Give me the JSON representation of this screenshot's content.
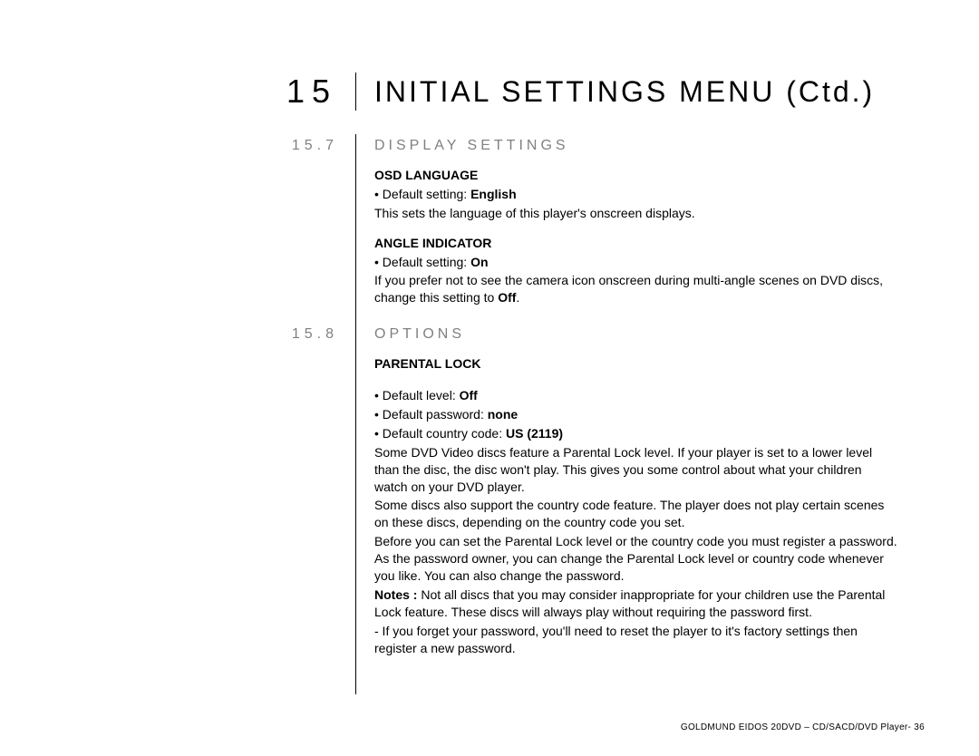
{
  "chapter": {
    "number": "15",
    "title": "INITIAL SETTINGS MENU (Ctd.)"
  },
  "sections": {
    "s1": {
      "num": "15.7",
      "title": "DISPLAY SETTINGS",
      "osd": {
        "head": "OSD LANGUAGE",
        "b1_pre": "• Default setting: ",
        "b1_bold": "English",
        "p1": "This sets the language of this player's onscreen displays."
      },
      "angle": {
        "head": "ANGLE INDICATOR",
        "b1_pre": "• Default setting: ",
        "b1_bold": "On",
        "p1_a": "If you prefer not to see the camera icon onscreen during multi-angle scenes on DVD discs, change this setting to ",
        "p1_b": "Off",
        "p1_c": "."
      }
    },
    "s2": {
      "num": "15.8",
      "title": "OPTIONS",
      "pl": {
        "head": "PARENTAL LOCK",
        "b1_pre": "• Default level: ",
        "b1_bold": "Off",
        "b2_pre": "• Default password: ",
        "b2_bold": "none",
        "b3_pre": "• Default country code: ",
        "b3_bold": "US (2119)",
        "p1": "Some DVD Video discs feature a Parental Lock level. If your player is set to a lower level than the disc, the disc won't play. This gives you some control about what your children watch on your DVD player.",
        "p2": "Some discs also support the country code feature. The player does not play certain scenes on these discs, depending on the country code you set.",
        "p3": "Before you can set the Parental Lock level or the country code you must register a password. As the password owner, you can change the Parental Lock level or country code whenever you like. You can also change the password.",
        "p4_a": "Notes :",
        "p4_b": " Not all discs that you may consider inappropriate for your children use the Parental Lock feature. These discs will always play without requiring the password first.",
        "p5": "- If you forget your password, you'll need to reset the player to it's factory settings then register a new password."
      }
    }
  },
  "footer": "GOLDMUND EIDOS 20DVD – CD/SACD/DVD Player- 36"
}
